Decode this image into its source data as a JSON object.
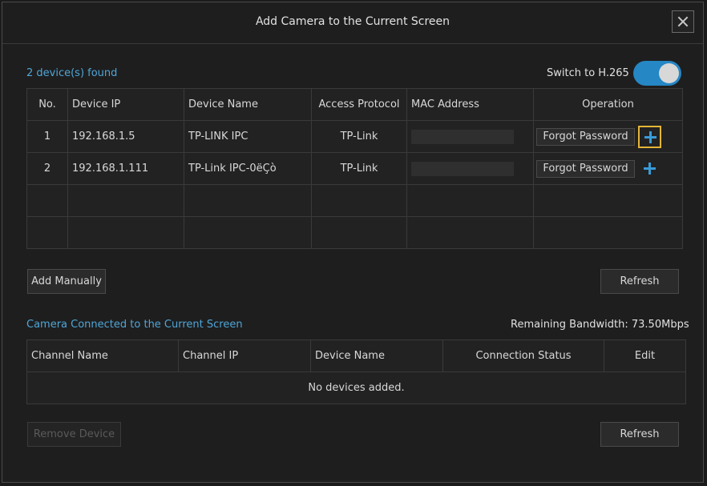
{
  "dialog": {
    "title": "Add Camera to the Current Screen"
  },
  "discovery": {
    "found_label": "2 device(s) found",
    "switch_label": "Switch to H.265",
    "switch_on": true,
    "columns": [
      "No.",
      "Device IP",
      "Device Name",
      "Access Protocol",
      "MAC Address",
      "Operation"
    ],
    "rows": [
      {
        "no": "1",
        "ip": "192.168.1.5",
        "name": "TP-LINK IPC",
        "protocol": "TP-Link",
        "forgot": "Forgot Password"
      },
      {
        "no": "2",
        "ip": "192.168.1.111",
        "name": "TP-Link IPC-0ëÇò",
        "protocol": "TP-Link",
        "forgot": "Forgot Password"
      }
    ],
    "add_manually": "Add Manually",
    "refresh": "Refresh"
  },
  "connected": {
    "label": "Camera Connected to the Current Screen",
    "bandwidth": "Remaining Bandwidth: 73.50Mbps",
    "columns": [
      "Channel Name",
      "Channel IP",
      "Device Name",
      "Connection Status",
      "Edit"
    ],
    "empty": "No devices added.",
    "remove": "Remove Device",
    "refresh": "Refresh"
  },
  "colors": {
    "accent": "#4fa6d6",
    "toggle": "#2587c4",
    "focus": "#e4b536"
  }
}
